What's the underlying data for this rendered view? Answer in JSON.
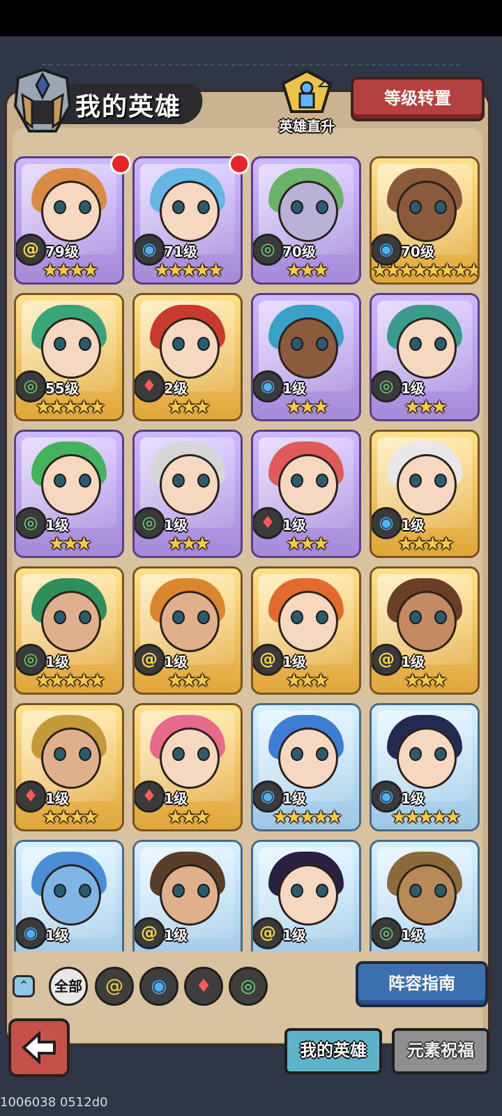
{
  "header": {
    "title": "我的英雄",
    "promo_label": "英雄直升",
    "level_transfer_button": "等级转置"
  },
  "heroes": [
    {
      "level": "79级",
      "element": "earth",
      "stars": "★★★★",
      "card": "purple",
      "badge": true,
      "hair": "#d98b44",
      "skin": "#f6d8c0"
    },
    {
      "level": "71级",
      "element": "water",
      "stars": "★★★★★",
      "card": "purple",
      "badge": true,
      "hair": "#64b6e6",
      "skin": "#f6d8c0"
    },
    {
      "level": "70级",
      "element": "wind",
      "stars": "★★★",
      "card": "purple",
      "badge": false,
      "hair": "#6ab46a",
      "skin": "#b9b2d6"
    },
    {
      "level": "70级",
      "element": "water",
      "stars": "★★★★★★★★",
      "card": "gold",
      "badge": false,
      "hair": "#8b5a3c",
      "skin": "#8b5a3c"
    },
    {
      "level": "55级",
      "element": "wind",
      "stars": "★★★★★",
      "card": "gold",
      "badge": false,
      "hair": "#3aa57a",
      "skin": "#f6d8c0"
    },
    {
      "level": "2级",
      "element": "fire",
      "stars": "★★★",
      "card": "gold",
      "badge": false,
      "hair": "#c83a2e",
      "skin": "#f6d8c0"
    },
    {
      "level": "1级",
      "element": "water",
      "stars": "★★★",
      "card": "purple",
      "badge": false,
      "hair": "#39a0c8",
      "skin": "#8c5a3c"
    },
    {
      "level": "1级",
      "element": "wind",
      "stars": "★★★",
      "card": "purple",
      "badge": false,
      "hair": "#3a9a8c",
      "skin": "#f6d8c0"
    },
    {
      "level": "1级",
      "element": "wind",
      "stars": "★★★",
      "card": "purple",
      "badge": false,
      "hair": "#44b35e",
      "skin": "#f6d8c0"
    },
    {
      "level": "1级",
      "element": "wind",
      "stars": "★★★",
      "card": "purple",
      "badge": false,
      "hair": "#d6d6d6",
      "skin": "#f6d8c0"
    },
    {
      "level": "1级",
      "element": "fire",
      "stars": "★★★",
      "card": "purple",
      "badge": false,
      "hair": "#e05a5a",
      "skin": "#f6d8c0"
    },
    {
      "level": "1级",
      "element": "water",
      "stars": "★★★★",
      "card": "gold",
      "badge": false,
      "hair": "#e8e8e8",
      "skin": "#f6d8c0"
    },
    {
      "level": "1级",
      "element": "wind",
      "stars": "★★★★★",
      "card": "gold",
      "badge": false,
      "hair": "#2f8f5a",
      "skin": "#e0b08c"
    },
    {
      "level": "1级",
      "element": "earth",
      "stars": "★★★",
      "card": "gold",
      "badge": false,
      "hair": "#d9862e",
      "skin": "#e0b08c"
    },
    {
      "level": "1级",
      "element": "earth",
      "stars": "★★★",
      "card": "gold",
      "badge": false,
      "hair": "#e36a2f",
      "skin": "#f6d8c0"
    },
    {
      "level": "1级",
      "element": "earth",
      "stars": "★★★",
      "card": "gold",
      "badge": false,
      "hair": "#6b3e2a",
      "skin": "#c58a62"
    },
    {
      "level": "1级",
      "element": "fire",
      "stars": "★★★★",
      "card": "gold",
      "badge": false,
      "hair": "#c69a3a",
      "skin": "#e0b08c"
    },
    {
      "level": "1级",
      "element": "fire",
      "stars": "★★★",
      "card": "gold",
      "badge": false,
      "hair": "#e76a8a",
      "skin": "#f6d8c0"
    },
    {
      "level": "1级",
      "element": "water",
      "stars": "★★★★★",
      "card": "blue",
      "badge": false,
      "hair": "#3d7dd6",
      "skin": "#f6d8c0"
    },
    {
      "level": "1级",
      "element": "water",
      "stars": "★★★★★",
      "card": "blue",
      "badge": false,
      "hair": "#232a52",
      "skin": "#f6d8c0"
    },
    {
      "level": "1级",
      "element": "water",
      "stars": "",
      "card": "blue",
      "badge": false,
      "hair": "#4a8fd6",
      "skin": "#7fb6e6"
    },
    {
      "level": "1级",
      "element": "earth",
      "stars": "",
      "card": "blue",
      "badge": false,
      "hair": "#5a3e2a",
      "skin": "#e0b08c"
    },
    {
      "level": "1级",
      "element": "earth",
      "stars": "",
      "card": "blue",
      "badge": false,
      "hair": "#2a2042",
      "skin": "#f6d8c0"
    },
    {
      "level": "1级",
      "element": "wind",
      "stars": "",
      "card": "blue",
      "badge": false,
      "hair": "#8b6a3c",
      "skin": "#b88a58"
    }
  ],
  "elements": {
    "earth": {
      "icon": "@",
      "color": "#f1d64a"
    },
    "water": {
      "icon": "◉",
      "color": "#4db2ff"
    },
    "fire": {
      "icon": "♦",
      "color": "#ff5a5a"
    },
    "wind": {
      "icon": "◎",
      "color": "#6ee07a"
    }
  },
  "filters": {
    "all_label": "全部",
    "chips": [
      "earth",
      "water",
      "fire",
      "wind"
    ]
  },
  "lineup_guide_button": "阵容指南",
  "tabs": {
    "my_heroes": "我的英雄",
    "element_blessing": "元素祝福"
  },
  "build_id": "1006038 0512d0"
}
